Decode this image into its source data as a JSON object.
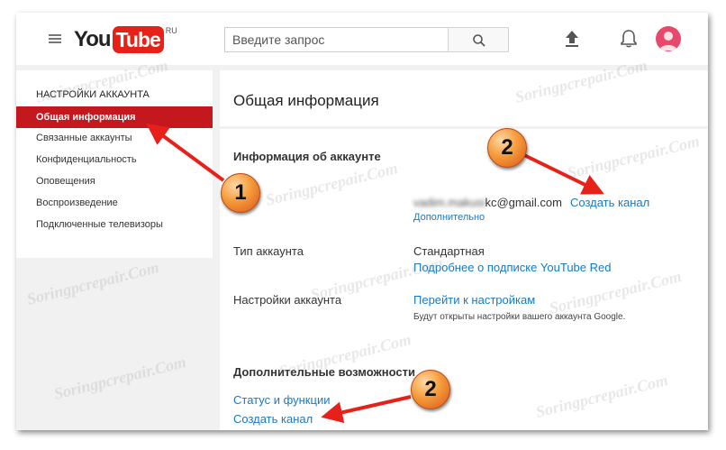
{
  "header": {
    "logo_you": "You",
    "logo_tube": "Tube",
    "logo_region": "RU",
    "search_placeholder": "Введите запрос",
    "icons": [
      "menu-icon",
      "search-icon",
      "upload-icon",
      "bell-icon",
      "avatar"
    ]
  },
  "sidebar": {
    "heading": "НАСТРОЙКИ АККАУНТА",
    "items": [
      {
        "label": "Общая информация",
        "active": true
      },
      {
        "label": "Связанные аккаунты",
        "active": false
      },
      {
        "label": "Конфиденциальность",
        "active": false
      },
      {
        "label": "Оповещения",
        "active": false
      },
      {
        "label": "Воспроизведение",
        "active": false
      },
      {
        "label": "Подключенные телевизоры",
        "active": false
      }
    ]
  },
  "main": {
    "title": "Общая информация",
    "account_info": {
      "title": "Информация об аккаунте",
      "email_hidden": "vadim.makusi",
      "email_visible": "kc@gmail.com",
      "create_channel": "Создать канал",
      "more": "Дополнительно"
    },
    "account_type": {
      "label": "Тип аккаунта",
      "value": "Стандартная",
      "link": "Подробнее о подписке YouTube Red"
    },
    "account_settings": {
      "label": "Настройки аккаунта",
      "link": "Перейти к настройкам",
      "note": "Будут открыты настройки вашего аккаунта Google."
    },
    "extra": {
      "title": "Дополнительные возможности",
      "status_link": "Статус и функции",
      "create_channel": "Создать канал"
    }
  },
  "annotations": {
    "badge1": "1",
    "badge2a": "2",
    "badge2b": "2",
    "arrow_color": "#e8201a"
  },
  "watermark": "Soringpcrepair.Com",
  "colors": {
    "brand_red": "#e62117",
    "active_item": "#c4181f",
    "link": "#167ac6"
  }
}
